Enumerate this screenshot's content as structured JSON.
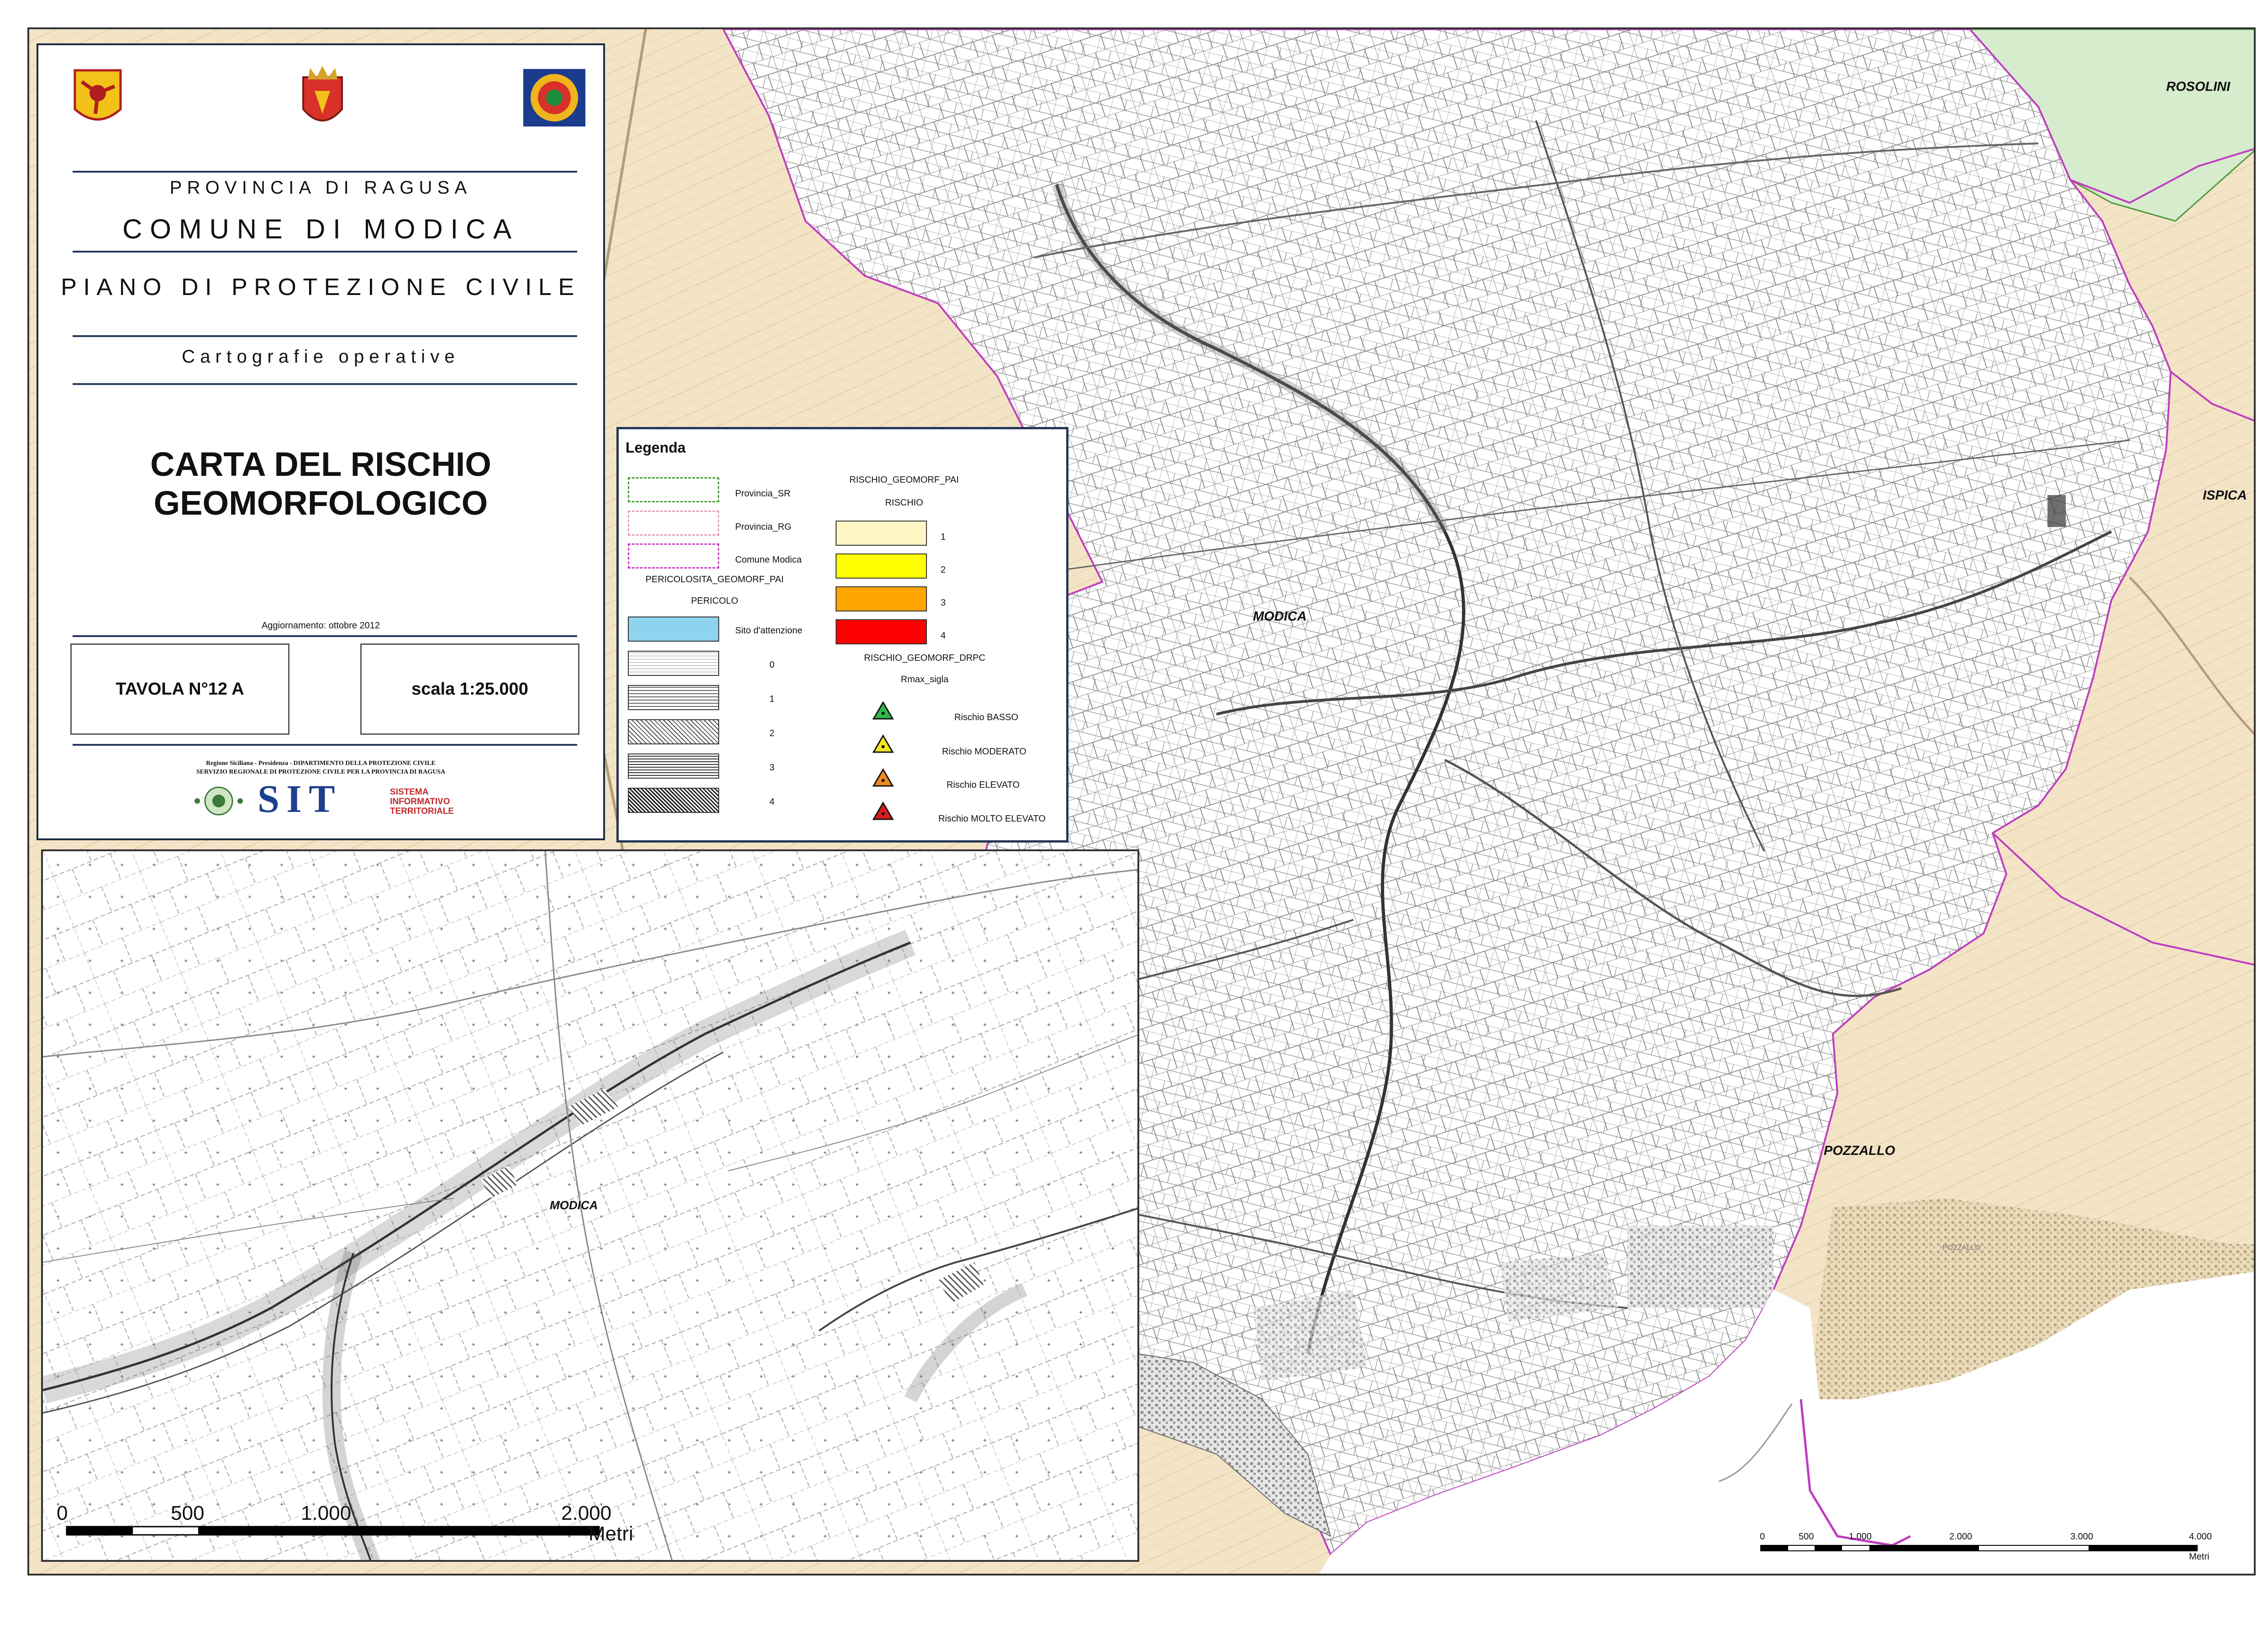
{
  "header": {
    "provincia": "PROVINCIA DI RAGUSA",
    "comune": "COMUNE DI MODICA",
    "piano": "PIANO DI PROTEZIONE CIVILE",
    "subtitle": "Cartografie operative",
    "map_title_line1": "CARTA DEL RISCHIO",
    "map_title_line2": "GEOMORFOLOGICO",
    "aggiornamento": "Aggiornamento: ottobre 2012",
    "tavola": "TAVOLA N°12 A",
    "scala": "scala 1:25.000"
  },
  "credits": {
    "line1": "Regione Siciliana - Presidenza - DIPARTIMENTO DELLA PROTEZIONE CIVILE",
    "line2": "SERVIZIO REGIONALE DI PROTEZIONE CIVILE PER LA PROVINCIA DI RAGUSA",
    "sit": "SIT",
    "sit_desc1": "SISTEMA",
    "sit_desc2": "INFORMATIVO",
    "sit_desc3": "TERRITORIALE"
  },
  "legend": {
    "title": "Legenda",
    "boundaries": [
      {
        "label": "Provincia_SR",
        "stroke": "#4a9a3a"
      },
      {
        "label": "Provincia_RG",
        "stroke": "#e79ab8"
      },
      {
        "label": "Comune Modica",
        "stroke": "#c03cc0"
      }
    ],
    "pericolosita_header": "PERICOLOSITA_GEOMORF_PAI",
    "pericolo_header": "PERICOLO",
    "pericolo_items": [
      {
        "label": "Sito d'attenzione",
        "fill": "#8fd4ee"
      },
      {
        "label": "0"
      },
      {
        "label": "1"
      },
      {
        "label": "2"
      },
      {
        "label": "3"
      },
      {
        "label": "4"
      }
    ],
    "rischio_pai_header": "RISCHIO_GEOMORF_PAI",
    "rischio_header": "RISCHIO",
    "rischio_items": [
      {
        "label": "1",
        "fill": "#fdf6c2"
      },
      {
        "label": "2",
        "fill": "#ffff00"
      },
      {
        "label": "3",
        "fill": "#ffa500"
      },
      {
        "label": "4",
        "fill": "#ff0000"
      }
    ],
    "drpc_header": "RISCHIO_GEOMORF_DRPC",
    "rmax_header": "Rmax_sigla",
    "rmax_items": [
      {
        "label": "Rischio BASSO",
        "fill": "#2db84a"
      },
      {
        "label": "Rischio MODERATO",
        "fill": "#f2e51f"
      },
      {
        "label": "Rischio ELEVATO",
        "fill": "#f08a1e"
      },
      {
        "label": "Rischio MOLTO ELEVATO",
        "fill": "#d91d1d"
      }
    ]
  },
  "map_labels": {
    "rosolini": "ROSOLINI",
    "ispica": "ISPICA",
    "modica": "MODICA",
    "pozzallo": "POZZALLO",
    "pozzallo_small": "POZZALLO",
    "inset_modica": "MODICA"
  },
  "colors": {
    "municipal_fill": "#f4e4c6",
    "sr_fill": "#d6eccd",
    "modica_boundary": "#c03cc0",
    "sea": "#ffffff",
    "line_dark": "#555555"
  },
  "scalebar_main": {
    "ticks": [
      "0",
      "500",
      "1.000",
      "2.000",
      "3.000",
      "4.000"
    ],
    "unit": "Metri"
  },
  "scalebar_inset": {
    "ticks": [
      "0",
      "500",
      "1.000",
      "2.000"
    ],
    "unit": "Metri"
  }
}
